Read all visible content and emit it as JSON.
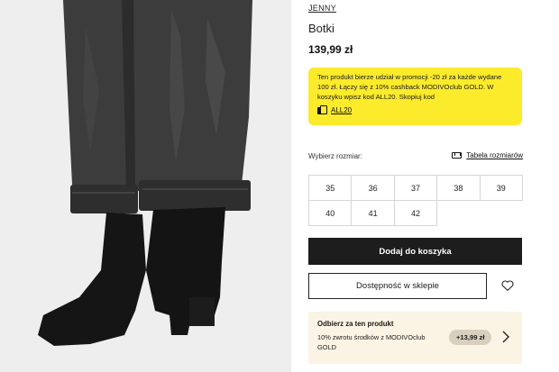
{
  "product": {
    "brand": "JENNY",
    "name": "Botki",
    "price": "139,99 zł"
  },
  "promo": {
    "text": "Ten produkt bierze udział w promocji -20 zł za każde wydane 100 zł. Łączy się z 10% cashback MODIVOclub GOLD. W koszyku wpisz kod ALL20. Skopiuj kod",
    "code": "ALL20",
    "color": "#fbeb2b"
  },
  "sizes": {
    "label": "Wybierz rozmiar:",
    "table_link": "Tabela rozmiarów",
    "options": [
      "35",
      "36",
      "37",
      "38",
      "39",
      "40",
      "41",
      "42"
    ]
  },
  "actions": {
    "add_to_cart": "Dodaj do koszyka",
    "store_availability": "Dostępność w sklepie"
  },
  "reward": {
    "title": "Odbierz za ten produkt",
    "description": "10% zwrotu środków z MODIVOclub GOLD",
    "amount": "+13,99 zł"
  }
}
